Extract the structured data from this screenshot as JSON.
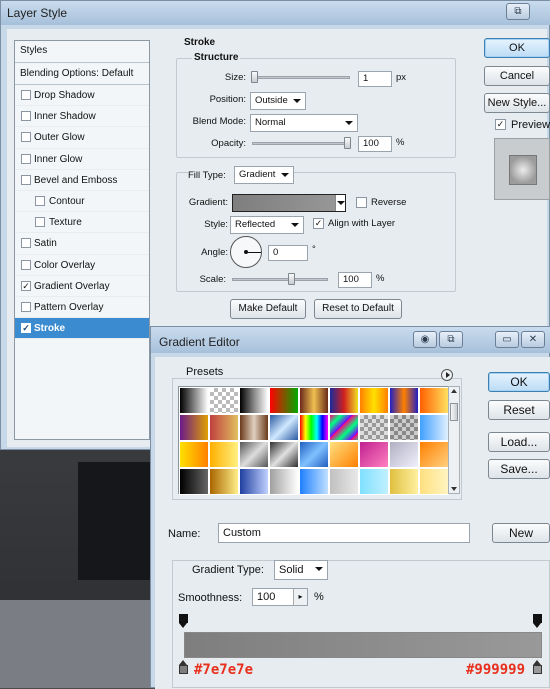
{
  "layer_style": {
    "title": "Layer Style",
    "styles_header": "Styles",
    "items": [
      {
        "label": "Blending Options: Default",
        "checked": false
      },
      {
        "label": "Drop Shadow",
        "checked": false
      },
      {
        "label": "Inner Shadow",
        "checked": false
      },
      {
        "label": "Outer Glow",
        "checked": false
      },
      {
        "label": "Inner Glow",
        "checked": false
      },
      {
        "label": "Bevel and Emboss",
        "checked": false
      },
      {
        "label": "Contour",
        "checked": false
      },
      {
        "label": "Texture",
        "checked": false
      },
      {
        "label": "Satin",
        "checked": false
      },
      {
        "label": "Color Overlay",
        "checked": false
      },
      {
        "label": "Gradient Overlay",
        "checked": true
      },
      {
        "label": "Pattern Overlay",
        "checked": false
      },
      {
        "label": "Stroke",
        "checked": true,
        "selected": true
      }
    ],
    "stroke": {
      "title": "Stroke",
      "structure": "Structure",
      "size_label": "Size:",
      "size_value": "1",
      "size_unit": "px",
      "position_label": "Position:",
      "position_value": "Outside",
      "blend_label": "Blend Mode:",
      "blend_value": "Normal",
      "opacity_label": "Opacity:",
      "opacity_value": "100",
      "opacity_unit": "%",
      "fill_type_label": "Fill Type:",
      "fill_type_value": "Gradient",
      "gradient_label": "Gradient:",
      "reverse_label": "Reverse",
      "reverse_checked": false,
      "style_label": "Style:",
      "style_value": "Reflected",
      "align_label": "Align with Layer",
      "align_checked": true,
      "angle_label": "Angle:",
      "angle_value": "0",
      "angle_unit": "°",
      "scale_label": "Scale:",
      "scale_value": "100",
      "scale_unit": "%",
      "make_default": "Make Default",
      "reset_default": "Reset to Default"
    },
    "buttons": {
      "ok": "OK",
      "cancel": "Cancel",
      "new_style": "New Style...",
      "preview": "Preview",
      "preview_checked": true
    }
  },
  "gradient_editor": {
    "title": "Gradient Editor",
    "presets_label": "Presets",
    "ok": "OK",
    "reset": "Reset",
    "load": "Load...",
    "save": "Save...",
    "name_label": "Name:",
    "name_value": "Custom",
    "new_button": "New",
    "gradient_type_label": "Gradient Type:",
    "gradient_type_value": "Solid",
    "smoothness_label": "Smoothness:",
    "smoothness_value": "100",
    "smoothness_unit": "%",
    "stop_left_color": "#7e7e7e",
    "stop_right_color": "#999999",
    "stop_left_label": "#7e7e7e",
    "stop_right_label": "#999999",
    "presets": [
      "linear-gradient(90deg,#000,#fff)",
      "repeating-conic-gradient(#bbb 0% 25%,#fff 0% 50%) 0 0/8px 8px",
      "linear-gradient(90deg,#000,#888,#fff)",
      "linear-gradient(90deg,#ff0000,#00aa00)",
      "linear-gradient(90deg,#6b2a1a,#f0c050,#6b2a1a)",
      "linear-gradient(90deg,#1a2a9a,#d02020,#f0e020)",
      "linear-gradient(90deg,#ff8000,#ffe000,#ff8000)",
      "linear-gradient(90deg,#2020c0,#ff8000,#2020c0)",
      "linear-gradient(90deg,#ff6000,#ffe060)",
      "linear-gradient(90deg,#6a1a8a,#e0a000)",
      "linear-gradient(90deg,#c04040,#e0c060)",
      "linear-gradient(90deg,#6a3a1a,#e0d0c0,#6a3a1a)",
      "linear-gradient(135deg,#2a5aa0,#d0e8ff,#2a5aa0)",
      "linear-gradient(90deg,#ff0000,#ffff00,#00ff00,#00ffff,#0000ff,#ff00ff)",
      "repeating-linear-gradient(135deg,#ff0080,#00ff80 8px,#8000ff 16px)",
      "repeating-conic-gradient(#999 0% 25%,#ddd 0% 50%) 0 0/8px 8px",
      "repeating-conic-gradient(#888 0% 25%,#ccc 0% 50%) 0 0/8px 8px",
      "linear-gradient(90deg,#40a0ff,#e0f0ff)",
      "linear-gradient(90deg,#ffe000,#ff8000)",
      "linear-gradient(90deg,#ffb000,#fff080)",
      "linear-gradient(135deg,#555,#ddd,#555)",
      "linear-gradient(135deg,#303030,#e0e0e0,#303030)",
      "linear-gradient(135deg,#2060c0,#80c0ff,#2060c0)",
      "linear-gradient(135deg,#ffe080,#ff8000)",
      "linear-gradient(135deg,#c02090,#ff80c0)",
      "linear-gradient(135deg,#b0b0c0,#f0f0ff)",
      "linear-gradient(135deg,#ff8000,#ffd080)",
      "linear-gradient(90deg,#000,#666)",
      "linear-gradient(90deg,#aa6600,#ffee88)",
      "linear-gradient(90deg,#2040a0,#c0d0ff)",
      "linear-gradient(90deg,#a0a0a0,#fff)",
      "linear-gradient(90deg,#2080ff,#c0e0ff)",
      "linear-gradient(90deg,#c0c0c0,#e8e8e8)",
      "linear-gradient(90deg,#80e0ff,#c0f0ff)",
      "linear-gradient(90deg,#e0c040,#fff0a0)",
      "linear-gradient(90deg,#ffe080,#fff4c0)"
    ]
  }
}
